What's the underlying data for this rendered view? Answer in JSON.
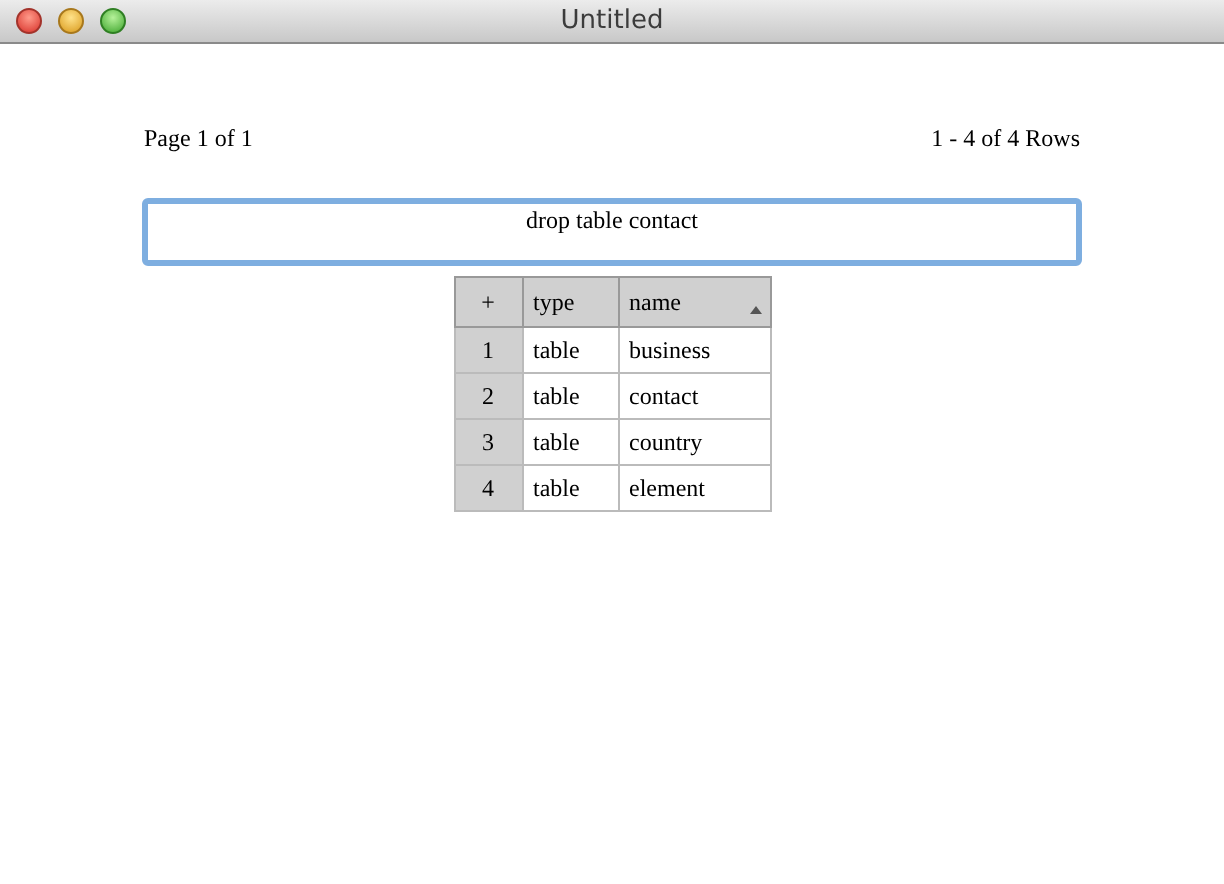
{
  "window": {
    "title": "Untitled"
  },
  "pager": {
    "page": "Page 1 of 1",
    "rows": "1 - 4 of 4 Rows"
  },
  "query": {
    "value": "drop table contact"
  },
  "table": {
    "columns": [
      {
        "label": "+",
        "sorted": false
      },
      {
        "label": "type",
        "sorted": false
      },
      {
        "label": "name",
        "sorted": true
      }
    ],
    "rows": [
      [
        "1",
        "table",
        "business"
      ],
      [
        "2",
        "table",
        "contact"
      ],
      [
        "3",
        "table",
        "country"
      ],
      [
        "4",
        "table",
        "element"
      ]
    ]
  }
}
